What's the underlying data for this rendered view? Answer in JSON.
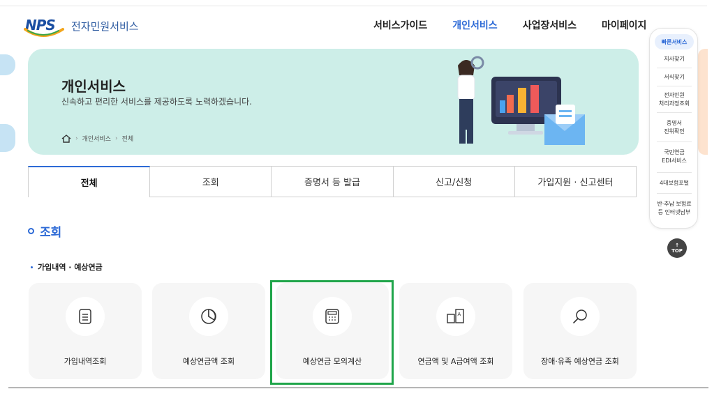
{
  "header": {
    "logo_mark": "NPS",
    "logo_text": "전자민원서비스",
    "nav": [
      "서비스가이드",
      "개인서비스",
      "사업장서비스",
      "마이페이지"
    ],
    "nav_active": "개인서비스"
  },
  "banner": {
    "title": "개인서비스",
    "subtitle": "신속하고 편리한 서비스를 제공하도록 노력하겠습니다.",
    "breadcrumb": [
      "개인서비스",
      "전체"
    ],
    "home_icon": "home-icon",
    "bg_color": "#cdeee8"
  },
  "quick_menu": {
    "header": "빠른서비스",
    "items": [
      "지사찾기",
      "서식찾기",
      "전자민원\n처리과정조회",
      "증명서\n진위확인",
      "국민연금\nEDI서비스",
      "4대보험포털",
      "반·추납 보험료\n등 인터넷납부"
    ],
    "top_label": "TOP"
  },
  "tabs": [
    "전체",
    "조회",
    "증명서 등 발급",
    "신고/신청",
    "가입지원 · 신고센터"
  ],
  "tab_active": "전체",
  "section": {
    "title": "조회",
    "subsection": "가입내역 · 예상연금"
  },
  "cards": [
    {
      "label": "가입내역조회",
      "icon": "document-list-icon"
    },
    {
      "label": "예상연금액 조회",
      "icon": "pie-chart-icon"
    },
    {
      "label": "예상연금 모의계산",
      "icon": "calculator-icon"
    },
    {
      "label": "연금액 및 A급여액 조회",
      "icon": "a-document-icon"
    },
    {
      "label": "장애·유족 예상연금 조회",
      "icon": "magnifier-icon"
    }
  ],
  "highlighted_card": "예상연금 모의계산",
  "colors": {
    "accent": "#2d6ad6",
    "highlight_border": "#1fa54a",
    "card_bg": "#f6f6f6"
  }
}
